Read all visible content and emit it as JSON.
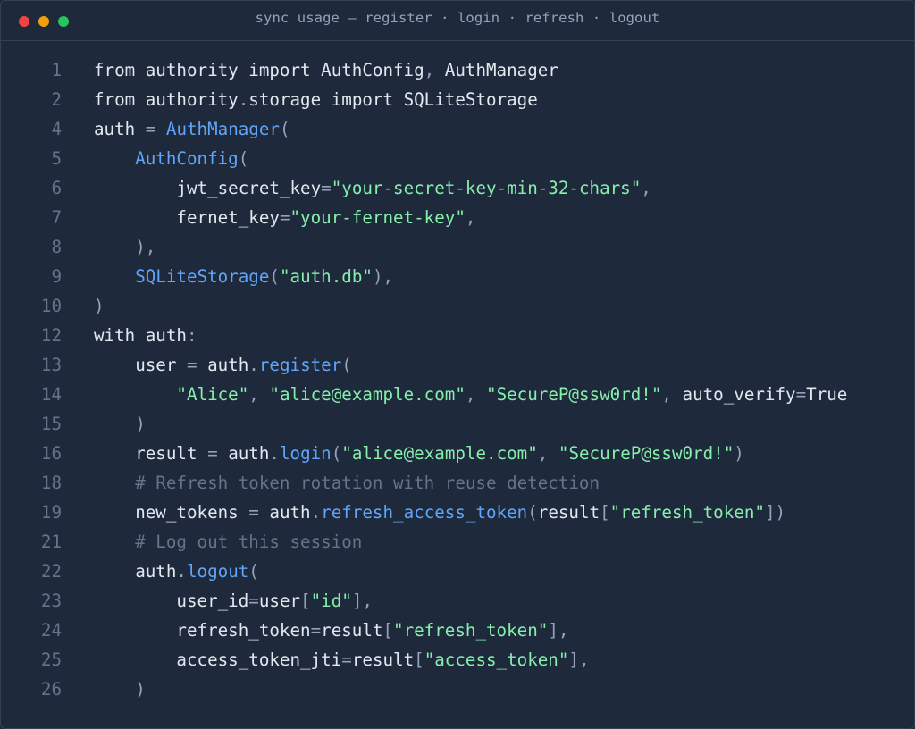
{
  "window": {
    "title": "sync usage — register · login · refresh · logout",
    "controls": [
      {
        "name": "close",
        "color": "#ef4444"
      },
      {
        "name": "minimize",
        "color": "#f59e0b"
      },
      {
        "name": "maximize",
        "color": "#22c55e"
      }
    ]
  },
  "code": {
    "lines": [
      {
        "num": "1",
        "tokens": [
          {
            "t": "from authority import AuthConfig",
            "c": "plain"
          },
          {
            "t": ",",
            "c": "punct"
          },
          {
            "t": " AuthManager",
            "c": "plain"
          }
        ]
      },
      {
        "num": "2",
        "tokens": [
          {
            "t": "from authority",
            "c": "plain"
          },
          {
            "t": ".",
            "c": "punct"
          },
          {
            "t": "storage import SQLiteStorage",
            "c": "plain"
          }
        ]
      },
      {
        "num": "4",
        "tokens": [
          {
            "t": "auth ",
            "c": "plain"
          },
          {
            "t": "=",
            "c": "punct"
          },
          {
            "t": " ",
            "c": "plain"
          },
          {
            "t": "AuthManager",
            "c": "fn"
          },
          {
            "t": "(",
            "c": "punct"
          }
        ]
      },
      {
        "num": "5",
        "tokens": [
          {
            "t": "    ",
            "c": "plain"
          },
          {
            "t": "AuthConfig",
            "c": "fn"
          },
          {
            "t": "(",
            "c": "punct"
          }
        ]
      },
      {
        "num": "6",
        "tokens": [
          {
            "t": "        jwt_secret_key",
            "c": "plain"
          },
          {
            "t": "=",
            "c": "punct"
          },
          {
            "t": "\"your-secret-key-min-32-chars\"",
            "c": "str"
          },
          {
            "t": ",",
            "c": "punct"
          }
        ]
      },
      {
        "num": "7",
        "tokens": [
          {
            "t": "        fernet_key",
            "c": "plain"
          },
          {
            "t": "=",
            "c": "punct"
          },
          {
            "t": "\"your-fernet-key\"",
            "c": "str"
          },
          {
            "t": ",",
            "c": "punct"
          }
        ]
      },
      {
        "num": "8",
        "tokens": [
          {
            "t": "    ),",
            "c": "punct"
          }
        ]
      },
      {
        "num": "9",
        "tokens": [
          {
            "t": "    ",
            "c": "plain"
          },
          {
            "t": "SQLiteStorage",
            "c": "fn"
          },
          {
            "t": "(",
            "c": "punct"
          },
          {
            "t": "\"auth.db\"",
            "c": "str"
          },
          {
            "t": "),",
            "c": "punct"
          }
        ]
      },
      {
        "num": "10",
        "tokens": [
          {
            "t": ")",
            "c": "punct"
          }
        ]
      },
      {
        "num": "12",
        "tokens": [
          {
            "t": "with auth",
            "c": "plain"
          },
          {
            "t": ":",
            "c": "punct"
          }
        ]
      },
      {
        "num": "13",
        "tokens": [
          {
            "t": "    user ",
            "c": "plain"
          },
          {
            "t": "=",
            "c": "punct"
          },
          {
            "t": " auth",
            "c": "plain"
          },
          {
            "t": ".",
            "c": "punct"
          },
          {
            "t": "register",
            "c": "fn"
          },
          {
            "t": "(",
            "c": "punct"
          }
        ]
      },
      {
        "num": "14",
        "tokens": [
          {
            "t": "        ",
            "c": "plain"
          },
          {
            "t": "\"Alice\"",
            "c": "str"
          },
          {
            "t": ", ",
            "c": "punct"
          },
          {
            "t": "\"alice@example.com\"",
            "c": "str"
          },
          {
            "t": ", ",
            "c": "punct"
          },
          {
            "t": "\"SecureP@ssw0rd!\"",
            "c": "str"
          },
          {
            "t": ", ",
            "c": "punct"
          },
          {
            "t": "auto_verify",
            "c": "plain"
          },
          {
            "t": "=",
            "c": "punct"
          },
          {
            "t": "True",
            "c": "plain"
          }
        ]
      },
      {
        "num": "15",
        "tokens": [
          {
            "t": "    )",
            "c": "punct"
          }
        ]
      },
      {
        "num": "16",
        "tokens": [
          {
            "t": "    result ",
            "c": "plain"
          },
          {
            "t": "=",
            "c": "punct"
          },
          {
            "t": " auth",
            "c": "plain"
          },
          {
            "t": ".",
            "c": "punct"
          },
          {
            "t": "login",
            "c": "fn"
          },
          {
            "t": "(",
            "c": "punct"
          },
          {
            "t": "\"alice@example.com\"",
            "c": "str"
          },
          {
            "t": ", ",
            "c": "punct"
          },
          {
            "t": "\"SecureP@ssw0rd!\"",
            "c": "str"
          },
          {
            "t": ")",
            "c": "punct"
          }
        ]
      },
      {
        "num": "18",
        "tokens": [
          {
            "t": "    # Refresh token rotation with reuse detection",
            "c": "comment"
          }
        ]
      },
      {
        "num": "19",
        "tokens": [
          {
            "t": "    new_tokens ",
            "c": "plain"
          },
          {
            "t": "=",
            "c": "punct"
          },
          {
            "t": " auth",
            "c": "plain"
          },
          {
            "t": ".",
            "c": "punct"
          },
          {
            "t": "refresh_access_token",
            "c": "fn"
          },
          {
            "t": "(",
            "c": "punct"
          },
          {
            "t": "result",
            "c": "plain"
          },
          {
            "t": "[",
            "c": "punct"
          },
          {
            "t": "\"refresh_token\"",
            "c": "str"
          },
          {
            "t": "])",
            "c": "punct"
          }
        ]
      },
      {
        "num": "21",
        "tokens": [
          {
            "t": "    # Log out this session",
            "c": "comment"
          }
        ]
      },
      {
        "num": "22",
        "tokens": [
          {
            "t": "    auth",
            "c": "plain"
          },
          {
            "t": ".",
            "c": "punct"
          },
          {
            "t": "logout",
            "c": "fn"
          },
          {
            "t": "(",
            "c": "punct"
          }
        ]
      },
      {
        "num": "23",
        "tokens": [
          {
            "t": "        user_id",
            "c": "plain"
          },
          {
            "t": "=",
            "c": "punct"
          },
          {
            "t": "user",
            "c": "plain"
          },
          {
            "t": "[",
            "c": "punct"
          },
          {
            "t": "\"id\"",
            "c": "str"
          },
          {
            "t": "],",
            "c": "punct"
          }
        ]
      },
      {
        "num": "24",
        "tokens": [
          {
            "t": "        refresh_token",
            "c": "plain"
          },
          {
            "t": "=",
            "c": "punct"
          },
          {
            "t": "result",
            "c": "plain"
          },
          {
            "t": "[",
            "c": "punct"
          },
          {
            "t": "\"refresh_token\"",
            "c": "str"
          },
          {
            "t": "],",
            "c": "punct"
          }
        ]
      },
      {
        "num": "25",
        "tokens": [
          {
            "t": "        access_token_jti",
            "c": "plain"
          },
          {
            "t": "=",
            "c": "punct"
          },
          {
            "t": "result",
            "c": "plain"
          },
          {
            "t": "[",
            "c": "punct"
          },
          {
            "t": "\"access_token\"",
            "c": "str"
          },
          {
            "t": "],",
            "c": "punct"
          }
        ]
      },
      {
        "num": "26",
        "tokens": [
          {
            "t": "    )",
            "c": "punct"
          }
        ]
      }
    ]
  }
}
